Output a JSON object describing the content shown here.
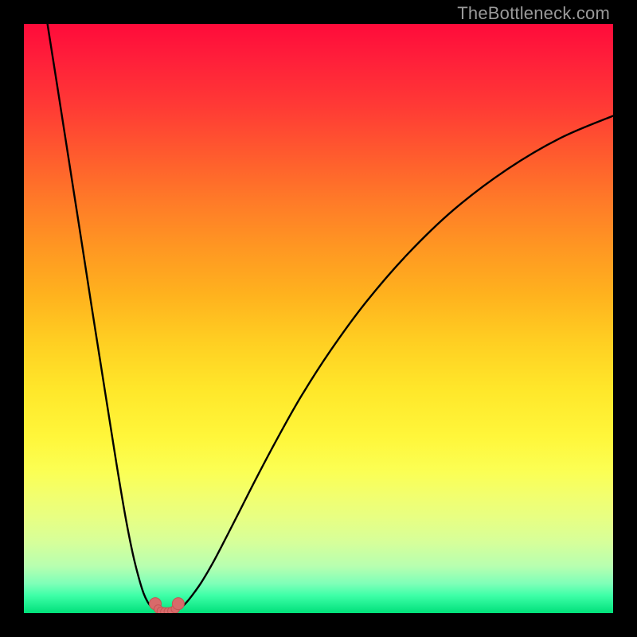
{
  "watermark": "TheBottleneck.com",
  "colors": {
    "frame": "#000000",
    "curve": "#000000",
    "marker_fill": "#d86a6a",
    "marker_stroke": "#c45555"
  },
  "chart_data": {
    "type": "line",
    "title": "",
    "xlabel": "",
    "ylabel": "",
    "xlim": [
      0,
      100
    ],
    "ylim": [
      0,
      100
    ],
    "grid": false,
    "series": [
      {
        "name": "left-branch",
        "x": [
          4.0,
          5.5,
          7.0,
          8.5,
          10.0,
          11.5,
          13.0,
          14.5,
          16.0,
          17.3,
          18.5,
          19.5,
          20.3,
          21.0,
          21.6,
          22.1,
          22.5
        ],
        "values": [
          100,
          90.5,
          80.9,
          71.3,
          61.7,
          52.0,
          42.5,
          33.0,
          23.6,
          16.0,
          10.0,
          6.0,
          3.4,
          1.9,
          1.1,
          0.7,
          0.5
        ]
      },
      {
        "name": "right-branch",
        "x": [
          26.0,
          26.5,
          27.2,
          28.0,
          29.0,
          30.3,
          32.0,
          34.0,
          36.4,
          39.5,
          43.0,
          47.0,
          52.0,
          58.0,
          65.0,
          73.0,
          82.0,
          91.0,
          100.0
        ],
        "values": [
          0.5,
          0.8,
          1.4,
          2.3,
          3.6,
          5.5,
          8.4,
          12.2,
          16.9,
          23.0,
          29.6,
          36.7,
          44.5,
          52.7,
          60.8,
          68.5,
          75.3,
          80.6,
          84.4
        ]
      },
      {
        "name": "valley-markers",
        "x": [
          22.3,
          22.8,
          23.3,
          23.9,
          24.5,
          25.1,
          25.7,
          26.2
        ],
        "values": [
          1.6,
          0.7,
          0.35,
          0.25,
          0.25,
          0.35,
          0.7,
          1.6
        ]
      }
    ],
    "annotations": []
  }
}
